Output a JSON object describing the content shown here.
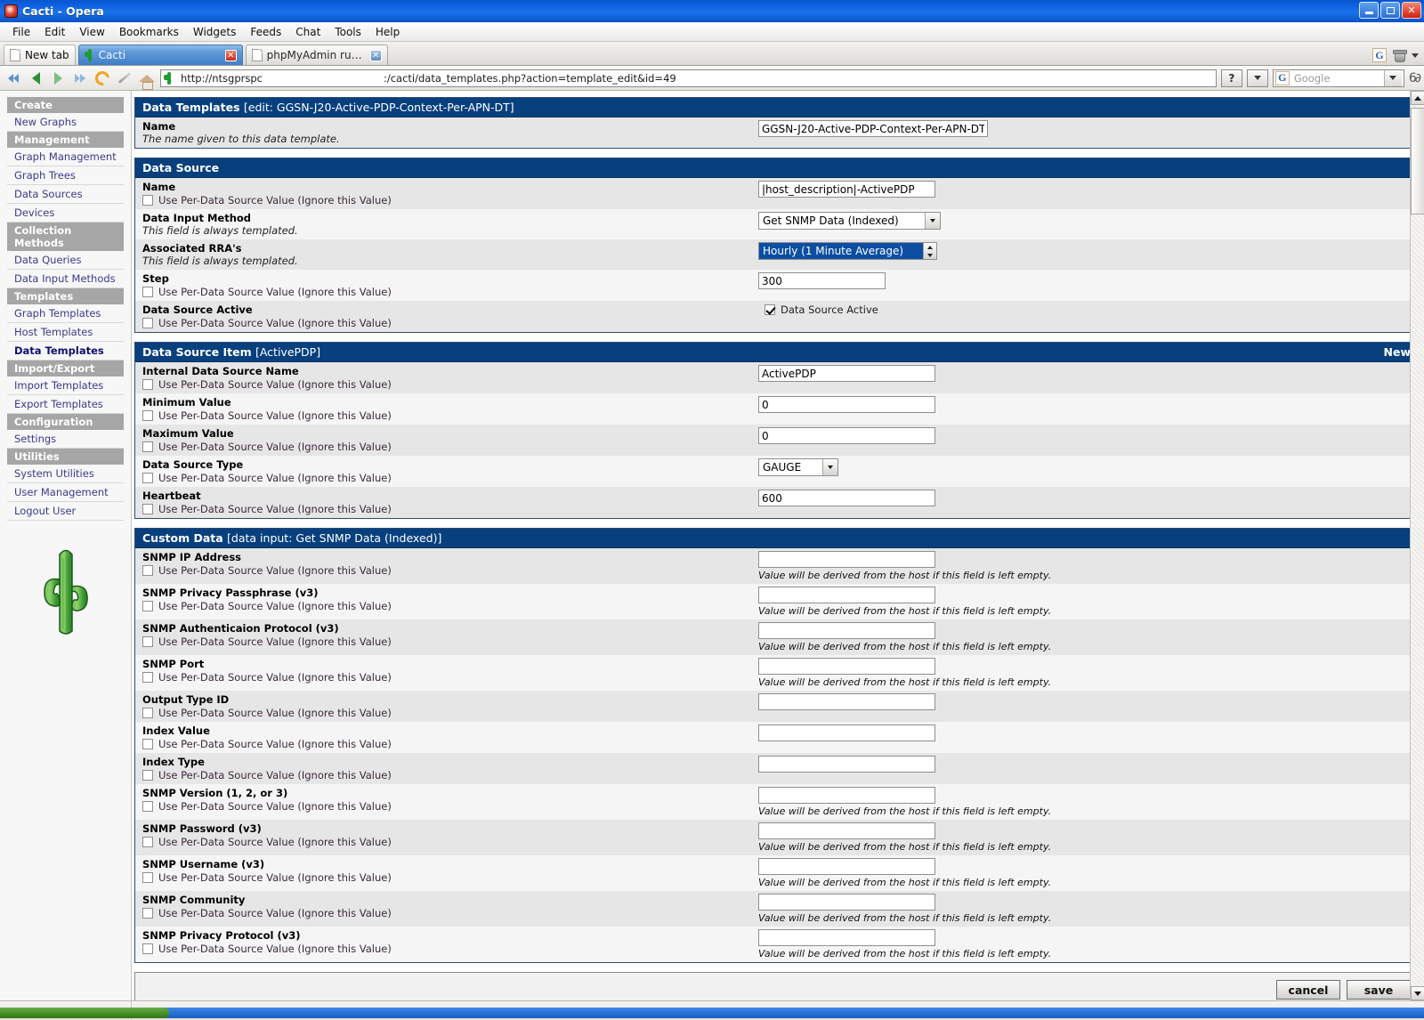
{
  "window": {
    "title": "Cacti - Opera",
    "minimize_label": "Minimize",
    "restore_label": "Restore",
    "close_label": "Close"
  },
  "menu": [
    "File",
    "Edit",
    "View",
    "Bookmarks",
    "Widgets",
    "Feeds",
    "Chat",
    "Tools",
    "Help"
  ],
  "tabs": {
    "new_tab_label": "New tab",
    "items": [
      {
        "label": "Cacti",
        "active": true
      },
      {
        "label": "phpMyAdmin running on l...",
        "active": false
      }
    ]
  },
  "address": {
    "host": "http://ntsgprspc",
    "path": ":/cacti/data_templates.php?action=template_edit&id=49",
    "help_button": "?",
    "search_placeholder": "Google"
  },
  "sidebar": {
    "groups": [
      {
        "header": "Create",
        "items": [
          {
            "label": "New Graphs",
            "selected": false
          }
        ]
      },
      {
        "header": "Management",
        "items": [
          {
            "label": "Graph Management",
            "selected": false
          },
          {
            "label": "Graph Trees",
            "selected": false
          },
          {
            "label": "Data Sources",
            "selected": false
          },
          {
            "label": "Devices",
            "selected": false
          }
        ]
      },
      {
        "header": "Collection Methods",
        "items": [
          {
            "label": "Data Queries",
            "selected": false
          },
          {
            "label": "Data Input Methods",
            "selected": false
          }
        ]
      },
      {
        "header": "Templates",
        "items": [
          {
            "label": "Graph Templates",
            "selected": false
          },
          {
            "label": "Host Templates",
            "selected": false
          },
          {
            "label": "Data Templates",
            "selected": true
          }
        ]
      },
      {
        "header": "Import/Export",
        "items": [
          {
            "label": "Import Templates",
            "selected": false
          },
          {
            "label": "Export Templates",
            "selected": false
          }
        ]
      },
      {
        "header": "Configuration",
        "items": [
          {
            "label": "Settings",
            "selected": false
          }
        ]
      },
      {
        "header": "Utilities",
        "items": [
          {
            "label": "System Utilities",
            "selected": false
          },
          {
            "label": "User Management",
            "selected": false
          },
          {
            "label": "Logout User",
            "selected": false
          }
        ]
      }
    ]
  },
  "checkbox_label": "Use Per-Data Source Value (Ignore this Value)",
  "derived_hint": "Value will be derived from the host if this field is left empty.",
  "sections": {
    "data_templates": {
      "title": "Data Templates",
      "subtitle": "[edit: GGSN-J20-Active-PDP-Context-Per-APN-DT]",
      "name_label": "Name",
      "name_desc": "The name given to this data template.",
      "name_value": "GGSN-J20-Active-PDP-Context-Per-APN-DT"
    },
    "data_source": {
      "title": "Data Source",
      "name_label": "Name",
      "name_value": "|host_description|-ActivePDP",
      "data_input_method_label": "Data Input Method",
      "data_input_method_desc": "This field is always templated.",
      "data_input_method_value": "Get SNMP Data (Indexed)",
      "associated_rras_label": "Associated RRA's",
      "associated_rras_desc": "This field is always templated.",
      "associated_rras_value": "Hourly (1 Minute Average)",
      "step_label": "Step",
      "step_value": "300",
      "active_label": "Data Source Active",
      "active_checkbox_label": "Data Source Active",
      "active_checked": true
    },
    "data_source_item": {
      "title": "Data Source Item",
      "subtitle": "[ActivePDP]",
      "new_link": "New",
      "fields": [
        {
          "label": "Internal Data Source Name",
          "value": "ActivePDP",
          "input": "name"
        },
        {
          "label": "Minimum Value",
          "value": "0",
          "input": "med"
        },
        {
          "label": "Maximum Value",
          "value": "0",
          "input": "med"
        },
        {
          "label": "Data Source Type",
          "value": "GAUGE",
          "input": "select"
        },
        {
          "label": "Heartbeat",
          "value": "600",
          "input": "med"
        }
      ]
    },
    "custom_data": {
      "title": "Custom Data",
      "subtitle": "[data input: Get SNMP Data (Indexed)]",
      "fields": [
        {
          "label": "SNMP IP Address",
          "value": "",
          "hint": true
        },
        {
          "label": "SNMP Privacy Passphrase (v3)",
          "value": "",
          "hint": true
        },
        {
          "label": "SNMP Authenticaion Protocol (v3)",
          "value": "",
          "hint": true
        },
        {
          "label": "SNMP Port",
          "value": "",
          "hint": true
        },
        {
          "label": "Output Type ID",
          "value": "",
          "hint": false
        },
        {
          "label": "Index Value",
          "value": "",
          "hint": false
        },
        {
          "label": "Index Type",
          "value": "",
          "hint": false
        },
        {
          "label": "SNMP Version (1, 2, or 3)",
          "value": "",
          "hint": true
        },
        {
          "label": "SNMP Password (v3)",
          "value": "",
          "hint": true
        },
        {
          "label": "SNMP Username (v3)",
          "value": "",
          "hint": true
        },
        {
          "label": "SNMP Community",
          "value": "",
          "hint": true
        },
        {
          "label": "SNMP Privacy Protocol (v3)",
          "value": "",
          "hint": true
        }
      ]
    }
  },
  "actions": {
    "cancel": "cancel",
    "save": "save"
  }
}
